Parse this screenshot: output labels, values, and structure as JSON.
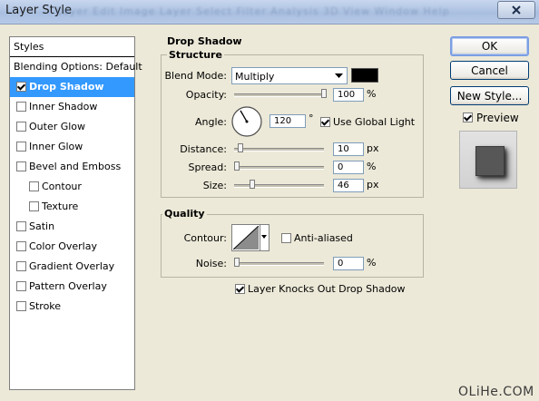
{
  "window": {
    "title": "Layer Style",
    "blurred_menu": "Layer  Edit  Image  Layer  Select  Filter  Analysis  3D  View  Window  Help"
  },
  "styles_panel": {
    "header": "Styles",
    "items": [
      {
        "label": "Blending Options: Default",
        "checkbox": false,
        "checked": false,
        "selected": false,
        "indent": false
      },
      {
        "label": "Drop Shadow",
        "checkbox": true,
        "checked": true,
        "selected": true,
        "indent": false
      },
      {
        "label": "Inner Shadow",
        "checkbox": true,
        "checked": false,
        "selected": false,
        "indent": false
      },
      {
        "label": "Outer Glow",
        "checkbox": true,
        "checked": false,
        "selected": false,
        "indent": false
      },
      {
        "label": "Inner Glow",
        "checkbox": true,
        "checked": false,
        "selected": false,
        "indent": false
      },
      {
        "label": "Bevel and Emboss",
        "checkbox": true,
        "checked": false,
        "selected": false,
        "indent": false
      },
      {
        "label": "Contour",
        "checkbox": true,
        "checked": false,
        "selected": false,
        "indent": true
      },
      {
        "label": "Texture",
        "checkbox": true,
        "checked": false,
        "selected": false,
        "indent": true
      },
      {
        "label": "Satin",
        "checkbox": true,
        "checked": false,
        "selected": false,
        "indent": false
      },
      {
        "label": "Color Overlay",
        "checkbox": true,
        "checked": false,
        "selected": false,
        "indent": false
      },
      {
        "label": "Gradient Overlay",
        "checkbox": true,
        "checked": false,
        "selected": false,
        "indent": false
      },
      {
        "label": "Pattern Overlay",
        "checkbox": true,
        "checked": false,
        "selected": false,
        "indent": false
      },
      {
        "label": "Stroke",
        "checkbox": true,
        "checked": false,
        "selected": false,
        "indent": false
      }
    ]
  },
  "drop_shadow": {
    "title": "Drop Shadow",
    "structure": {
      "title": "Structure",
      "blend_mode_label": "Blend Mode:",
      "blend_mode_value": "Multiply",
      "shadow_color": "#000000",
      "opacity_label": "Opacity:",
      "opacity_value": "100",
      "opacity_unit": "%",
      "opacity_level": 1.0,
      "angle_label": "Angle:",
      "angle_value": "120",
      "angle_unit": "°",
      "angle_degrees": 120,
      "use_global_light_label": "Use Global Light",
      "use_global_light_checked": true,
      "distance_label": "Distance:",
      "distance_value": "10",
      "distance_unit": "px",
      "distance_level": 0.04,
      "spread_label": "Spread:",
      "spread_value": "0",
      "spread_unit": "%",
      "spread_level": 0.0,
      "size_label": "Size:",
      "size_value": "46",
      "size_unit": "px",
      "size_level": 0.18
    },
    "quality": {
      "title": "Quality",
      "contour_label": "Contour:",
      "anti_aliased_label": "Anti-aliased",
      "anti_aliased_checked": false,
      "noise_label": "Noise:",
      "noise_value": "0",
      "noise_unit": "%",
      "noise_level": 0.0
    },
    "knockout_label": "Layer Knocks Out Drop Shadow",
    "knockout_checked": true
  },
  "buttons": {
    "ok": "OK",
    "cancel": "Cancel",
    "new_style": "New Style..."
  },
  "preview": {
    "label": "Preview",
    "checked": true
  },
  "watermark": "OLiHe.COM"
}
